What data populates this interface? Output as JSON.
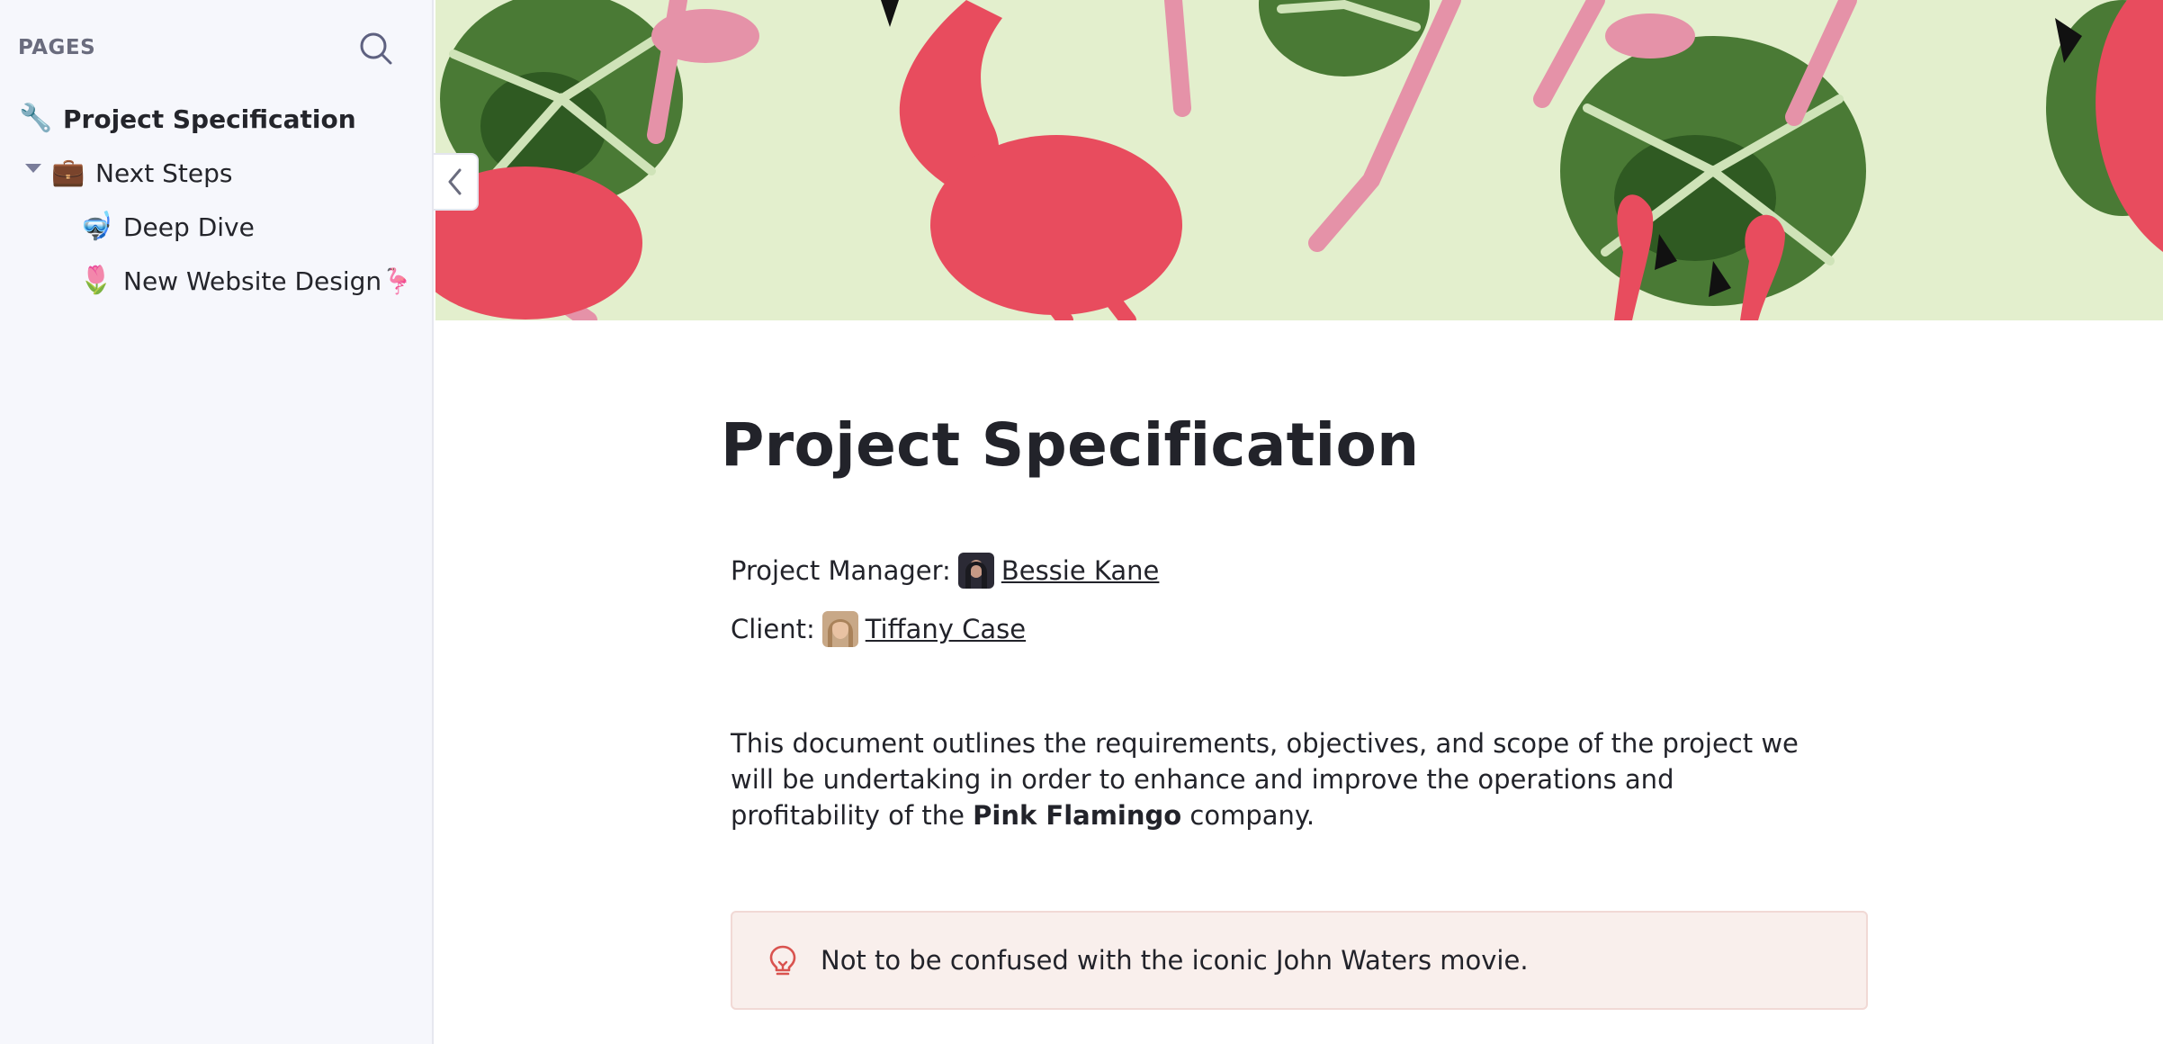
{
  "sidebar": {
    "header": "PAGES",
    "pages": [
      {
        "emoji": "🔧",
        "label": "Project Specification"
      },
      {
        "emoji": "💼",
        "label": "Next Steps"
      },
      {
        "emoji": "🤿",
        "label": "Deep Dive"
      },
      {
        "emoji": "🌷",
        "label": "New Website Design🦩"
      }
    ]
  },
  "document": {
    "title": "Project Specification",
    "manager_label": "Project Manager:",
    "manager_name": "Bessie Kane",
    "client_label": "Client:",
    "client_name": "Tiffany Case",
    "description_part1": "This document outlines the requirements, objectives, and scope of the project we will be undertaking in order to enhance and improve the operations and profitability of the ",
    "description_bold": "Pink Flamingo",
    "description_part2": " company.",
    "callout_text": "Not to be confused with the iconic John Waters movie."
  },
  "colors": {
    "sidebar_bg": "#f6f7fc",
    "banner_bg": "#e3efcd",
    "flamingo": "#e84c5e",
    "flamingo_light": "#e592a8",
    "leaf": "#4a7a35",
    "callout_bg": "#f9efec",
    "callout_icon": "#d9534f"
  },
  "icons": {
    "search": "search-icon",
    "collapse": "chevron-left-icon",
    "callout": "lightbulb-icon"
  }
}
